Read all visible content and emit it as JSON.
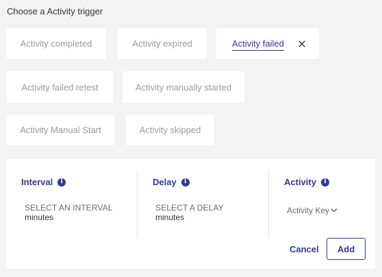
{
  "header": {
    "title": "Choose a Activity trigger"
  },
  "triggers": [
    {
      "label": "Activity completed",
      "selected": false
    },
    {
      "label": "Activity expired",
      "selected": false
    },
    {
      "label": "Activity failed",
      "selected": true
    },
    {
      "label": "Activity failed retest",
      "selected": false
    },
    {
      "label": "Activity manually started",
      "selected": false
    },
    {
      "label": "Activity Manual Start",
      "selected": false
    },
    {
      "label": "Activity skipped",
      "selected": false
    }
  ],
  "config": {
    "interval": {
      "label": "Interval",
      "placeholder": "SELECT AN INTERVAL",
      "value": "minutes"
    },
    "delay": {
      "label": "Delay",
      "placeholder": "SELECT A DELAY",
      "value": "minutes"
    },
    "activity": {
      "label": "Activity",
      "value": "Activity Key"
    }
  },
  "actions": {
    "cancel_label": "Cancel",
    "add_label": "Add"
  },
  "icons": {
    "info": "info-icon",
    "close": "close-icon",
    "dropdown": "chevron-down-icon"
  },
  "colors": {
    "accent": "#2f3a8f",
    "background": "#f3f3f4",
    "muted_text": "#9a9a9a"
  }
}
